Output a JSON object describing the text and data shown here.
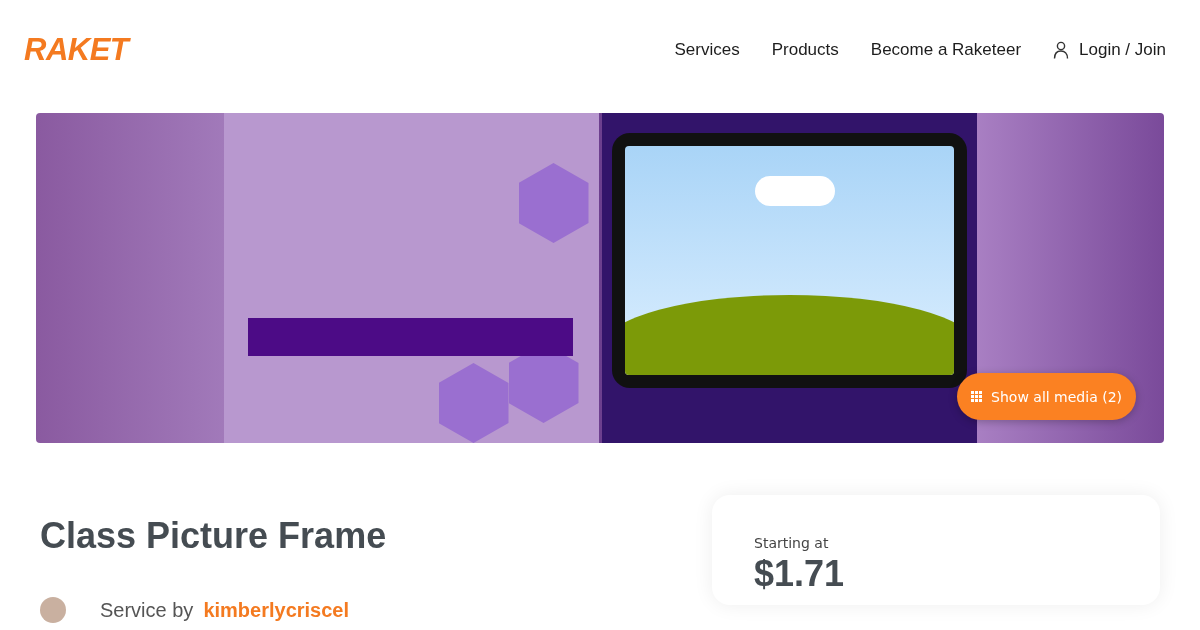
{
  "header": {
    "logo": "RAKET",
    "nav": [
      {
        "label": "Services"
      },
      {
        "label": "Products"
      },
      {
        "label": "Become a Raketeer"
      }
    ],
    "login": "Login / Join"
  },
  "gallery": {
    "show_all_button": "Show all media (2)"
  },
  "service": {
    "title": "Class Picture Frame",
    "by_label": "Service by",
    "author": "kimberlycriscel"
  },
  "pricing": {
    "label": "Starting at",
    "price": "$1.71"
  }
}
